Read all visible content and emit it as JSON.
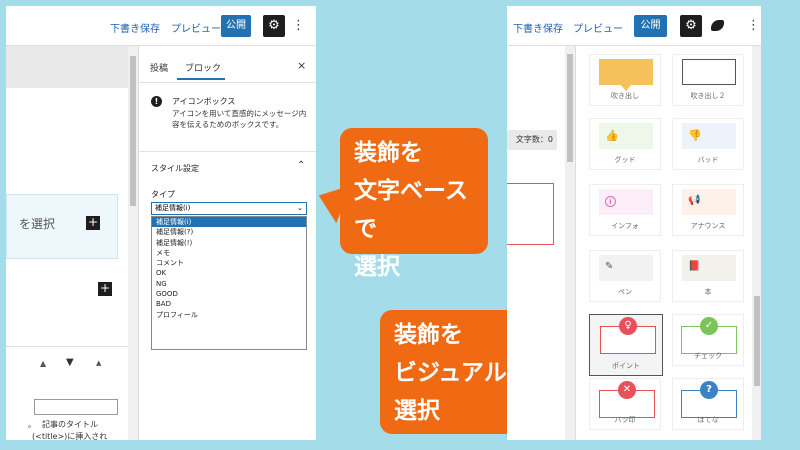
{
  "left_window": {
    "toolbar": {
      "draft": "下書き保存",
      "preview": "プレビュー",
      "publish": "公開"
    },
    "sidebar": {
      "tab_post": "投稿",
      "tab_block": "ブロック",
      "close": "×",
      "block_name": "アイコンボックス",
      "block_desc": "アイコンを用いて直感的にメッセージ内容を伝えるためのボックスです。",
      "section_style": "スタイル設定",
      "type_label": "タイプ",
      "select_value": "補足情報(i)",
      "options": [
        "補足情報(i)",
        "補足情報(?)",
        "補足情報(!)",
        "メモ",
        "コメント",
        "OK",
        "NG",
        "GOOD",
        "BAD",
        "プロフィール"
      ],
      "selected_index": 0
    },
    "editor": {
      "select_text": "を選択",
      "caption_line1": "記事のタイトル",
      "caption_line2": "(<title>)に挿入され",
      "caption_prefix": "。"
    }
  },
  "callouts": {
    "text_based": [
      "装飾を",
      "文字ベースで",
      "選択"
    ],
    "visual_based": [
      "装飾を",
      "ビジュアルで",
      "選択"
    ]
  },
  "right_window": {
    "toolbar": {
      "draft": "下書き保存",
      "preview": "プレビュー",
      "publish": "公開"
    },
    "char_count": "文字数：0",
    "styles": [
      {
        "label": "吹き出し"
      },
      {
        "label": "吹き出し２"
      },
      {
        "label": "グッド"
      },
      {
        "label": "バッド"
      },
      {
        "label": "インフォ"
      },
      {
        "label": "アナウンス"
      },
      {
        "label": "ペン"
      },
      {
        "label": "本"
      },
      {
        "label": "ポイント"
      },
      {
        "label": "チェック"
      },
      {
        "label": "バツ印"
      },
      {
        "label": "はてな"
      }
    ],
    "selected_style": "ポイント"
  },
  "colors": {
    "accent": "#2271b1",
    "callout": "#ef6a12",
    "background": "#a5dcea",
    "point": "#e8505b",
    "check": "#7cc45a",
    "question": "#3b82c4"
  }
}
